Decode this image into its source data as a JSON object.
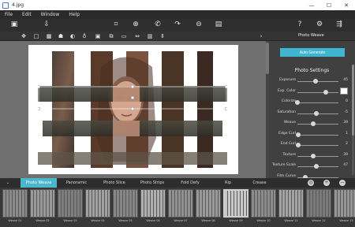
{
  "window": {
    "title": "4.jpg",
    "controls": [
      "—",
      "☐",
      "✕"
    ]
  },
  "menu": [
    "File",
    "Edit",
    "Window",
    "Help"
  ],
  "panel": {
    "title": "Photo Weave",
    "generate_label": "Auto Generate",
    "section_title": "Photo Settings",
    "settings": [
      {
        "label": "Exposure",
        "value": "45",
        "pos": 0.45
      },
      {
        "label": "Exp. Color",
        "value": "",
        "pos": 0.7,
        "swatch": "#ffffff"
      },
      {
        "label": "Colorize",
        "value": "0",
        "pos": 0.0
      },
      {
        "label": "Saturation",
        "value": "-5",
        "pos": 0.47
      },
      {
        "label": "Weave",
        "value": "39",
        "pos": 0.39
      },
      {
        "label": "Edge Curl",
        "value": "1",
        "pos": 0.01
      },
      {
        "label": "End Curl",
        "value": "2",
        "pos": 0.02
      },
      {
        "label": "Texture",
        "value": "39",
        "pos": 0.39
      },
      {
        "label": "Texture Scale",
        "value": "47",
        "pos": 0.47
      },
      {
        "label": "Film Curve",
        "value": "",
        "pos": 0.2
      }
    ]
  },
  "tabs": [
    "Photo Weave",
    "Panoramic",
    "Photo Slice",
    "Photo Strips",
    "Fold Defy",
    "Rip",
    "Crease"
  ],
  "active_tab": 0,
  "presets": [
    "Weave 01",
    "Weave 02",
    "Weave 03",
    "Weave 04",
    "Weave 05",
    "Weave 06",
    "Weave 07",
    "Weave 08",
    "Weave 09",
    "Weave 10",
    "Weave 11",
    "Weave 12",
    "Weave 13"
  ],
  "selected_preset": 8
}
